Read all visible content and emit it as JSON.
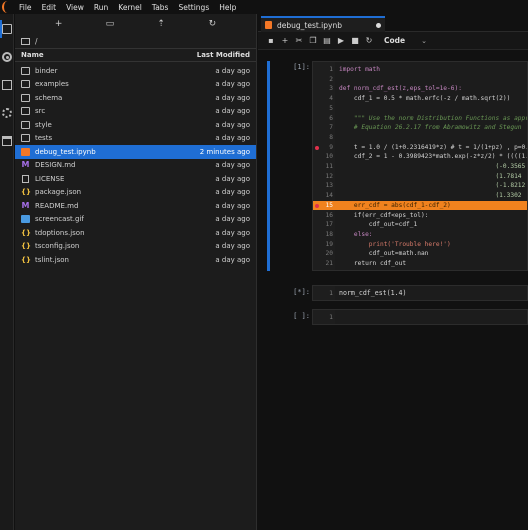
{
  "menu": [
    "File",
    "Edit",
    "View",
    "Run",
    "Kernel",
    "Tabs",
    "Settings",
    "Help"
  ],
  "breadcrumb": "/",
  "file_browser": {
    "header_name": "Name",
    "header_modified": "Last Modified",
    "files": [
      {
        "name": "binder",
        "modified": "a day ago",
        "type": "folder"
      },
      {
        "name": "examples",
        "modified": "a day ago",
        "type": "folder"
      },
      {
        "name": "schema",
        "modified": "a day ago",
        "type": "folder"
      },
      {
        "name": "src",
        "modified": "a day ago",
        "type": "folder"
      },
      {
        "name": "style",
        "modified": "a day ago",
        "type": "folder"
      },
      {
        "name": "tests",
        "modified": "a day ago",
        "type": "folder"
      },
      {
        "name": "debug_test.ipynb",
        "modified": "2 minutes ago",
        "type": "notebook"
      },
      {
        "name": "DESIGN.md",
        "modified": "a day ago",
        "type": "markdown"
      },
      {
        "name": "LICENSE",
        "modified": "a day ago",
        "type": "file"
      },
      {
        "name": "package.json",
        "modified": "a day ago",
        "type": "json"
      },
      {
        "name": "README.md",
        "modified": "a day ago",
        "type": "markdown"
      },
      {
        "name": "screencast.gif",
        "modified": "a day ago",
        "type": "image"
      },
      {
        "name": "tdoptions.json",
        "modified": "a day ago",
        "type": "json"
      },
      {
        "name": "tsconfig.json",
        "modified": "a day ago",
        "type": "json"
      },
      {
        "name": "tslint.json",
        "modified": "a day ago",
        "type": "json"
      }
    ]
  },
  "notebook": {
    "tab_title": "debug_test.ipynb",
    "cell_type": "Code",
    "cells": [
      {
        "prompt": "[1]:",
        "lines": [
          {
            "n": "1",
            "text": "import math"
          },
          {
            "n": "2",
            "text": ""
          },
          {
            "n": "3",
            "text": "def norm_cdf_est(z,eps_tol=1e-6):"
          },
          {
            "n": "4",
            "text": "    cdf_1 = 0.5 * math.erfc(-z / math.sqrt(2))"
          },
          {
            "n": "5",
            "text": ""
          },
          {
            "n": "6",
            "text": "    \"\"\" Use the norm Distribution Functions as approx"
          },
          {
            "n": "7",
            "text": "    # Equation 26.2.17 from Abramowitz and Stegun"
          },
          {
            "n": "8",
            "text": ""
          },
          {
            "n": "9",
            "text": "    t = 1.0 / (1+0.2316419*z) # t = 1/(1+pz) , p=0.2"
          },
          {
            "n": "10",
            "text": "    cdf_2 = 1 - 0.3989423*math.exp(-z*z/2) * ((((1.33"
          },
          {
            "n": "11",
            "text": "                                          (-0.3565"
          },
          {
            "n": "12",
            "text": "                                          (1.7814"
          },
          {
            "n": "13",
            "text": "                                          (-1.8212"
          },
          {
            "n": "14",
            "text": "                                          (1.3302"
          },
          {
            "n": "15",
            "text": "    err_cdf = abs(cdf_1-cdf_2)"
          },
          {
            "n": "16",
            "text": "    if(err_cdf<eps_tol):"
          },
          {
            "n": "17",
            "text": "        cdf_out=cdf_1"
          },
          {
            "n": "18",
            "text": "    else:"
          },
          {
            "n": "19",
            "text": "        print('Trouble here!')"
          },
          {
            "n": "20",
            "text": "        cdf_out=math.nan"
          },
          {
            "n": "21",
            "text": "    return cdf_out"
          }
        ]
      },
      {
        "prompt": "[*]:",
        "lines": [
          {
            "n": "1",
            "text": "norm_cdf_est(1.4)"
          }
        ]
      },
      {
        "prompt": "[ ]:",
        "lines": [
          {
            "n": "1",
            "text": ""
          }
        ]
      }
    ]
  },
  "colors": {
    "accent": "#1f6ed4",
    "breakpoint": "#e0314b",
    "highlight": "#f0821e",
    "notebook_icon": "#f37726"
  }
}
